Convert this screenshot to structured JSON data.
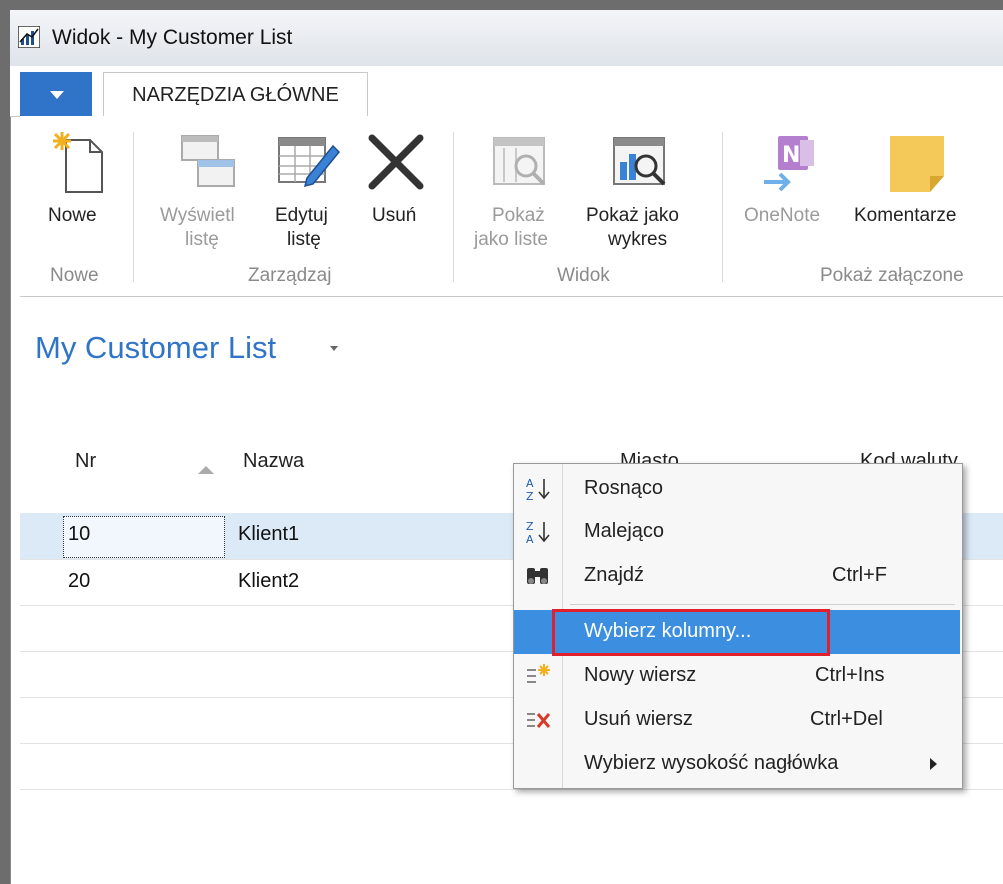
{
  "window": {
    "title": "Widok - My Customer List"
  },
  "ribbon": {
    "tab_home": "NARZĘDZIA GŁÓWNE",
    "buttons": {
      "new": "Nowe",
      "show_list": [
        "Wyświetl",
        "listę"
      ],
      "edit_list": [
        "Edytuj",
        "listę"
      ],
      "delete": "Usuń",
      "show_as_list": [
        "Pokaż",
        "jako liste"
      ],
      "show_as_chart": [
        "Pokaż jako",
        "wykres"
      ],
      "onenote": "OneNote",
      "comments": "Komentarze"
    },
    "groups": {
      "new": "Nowe",
      "manage": "Zarządzaj",
      "view": "Widok",
      "attachments": "Pokaż załączone"
    }
  },
  "page": {
    "title": "My Customer List"
  },
  "grid": {
    "columns": [
      "Nr",
      "Nazwa",
      "Miasto",
      "Kod waluty"
    ],
    "rows": [
      {
        "nr": "10",
        "nazwa": "Klient1"
      },
      {
        "nr": "20",
        "nazwa": "Klient2"
      }
    ]
  },
  "context_menu": {
    "items": [
      {
        "label": "Rosnąco",
        "shortcut": "",
        "icon": "sort-ascending-icon"
      },
      {
        "label": "Malejąco",
        "shortcut": "",
        "icon": "sort-descending-icon"
      },
      {
        "label": "Znajdź",
        "shortcut": "Ctrl+F",
        "icon": "binoculars-icon"
      },
      {
        "label": "Wybierz kolumny...",
        "shortcut": "",
        "icon": ""
      },
      {
        "label": "Nowy wiersz",
        "shortcut": "Ctrl+Ins",
        "icon": "new-row-icon"
      },
      {
        "label": "Usuń wiersz",
        "shortcut": "Ctrl+Del",
        "icon": "delete-row-icon"
      },
      {
        "label": "Wybierz wysokość nagłówka",
        "shortcut": "",
        "icon": ""
      }
    ],
    "highlighted_index": 3
  },
  "colors": {
    "accent": "#2f74c8",
    "menu_highlight": "#3b8ee0",
    "annotation": "#e0202a",
    "row_selected": "#dce9f6"
  }
}
